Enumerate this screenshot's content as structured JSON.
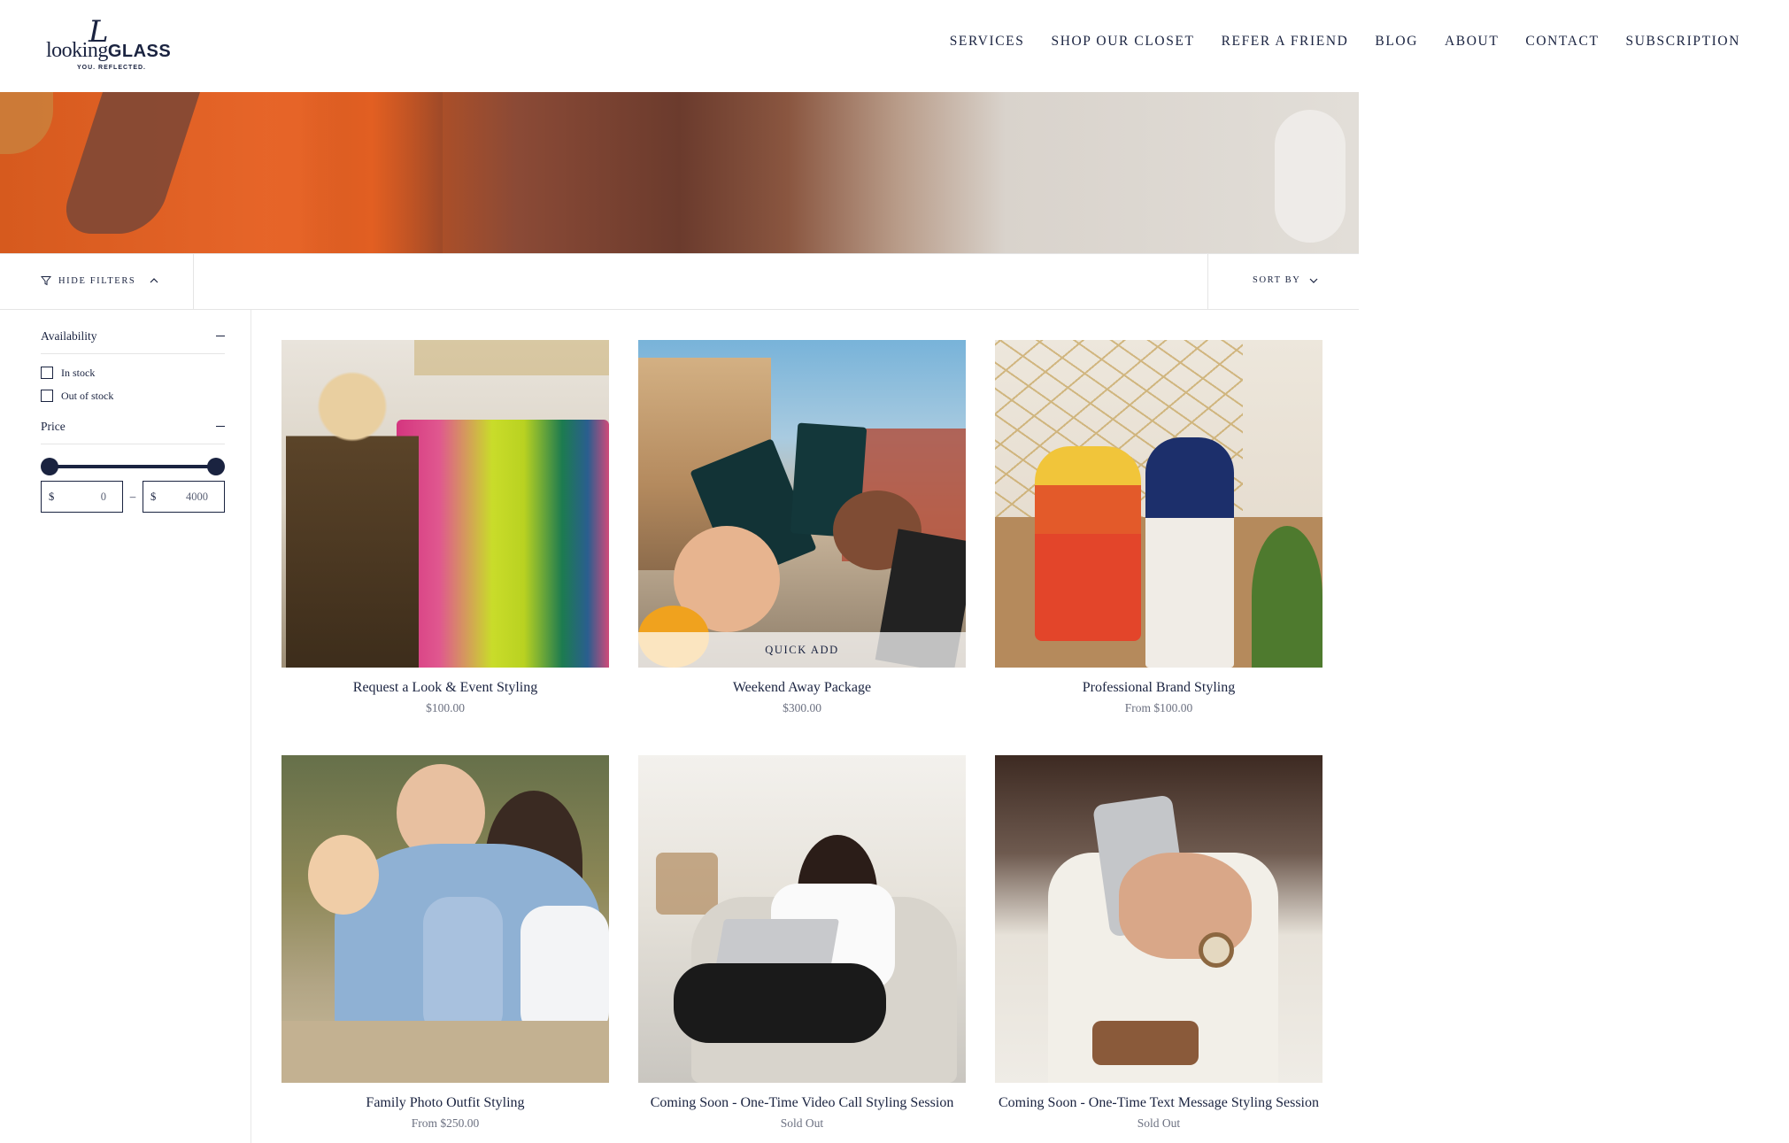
{
  "brand": {
    "logo_mark": "L",
    "logo_word": "looking",
    "logo_word_bold": "GLASS",
    "tagline": "YOU. REFLECTED."
  },
  "nav": [
    "SERVICES",
    "SHOP OUR CLOSET",
    "REFER A FRIEND",
    "BLOG",
    "ABOUT",
    "CONTACT",
    "SUBSCRIPTION"
  ],
  "toolbar": {
    "hide_filters": "HIDE FILTERS",
    "sort_by": "SORT BY"
  },
  "filters": {
    "availability": {
      "title": "Availability",
      "options": [
        "In stock",
        "Out of stock"
      ]
    },
    "price": {
      "title": "Price",
      "currency": "$",
      "min": "0",
      "max": "4000",
      "separator": "–"
    }
  },
  "products": [
    {
      "title": "Request a Look & Event Styling",
      "price": "$100.00"
    },
    {
      "title": "Weekend Away Package",
      "price": "$300.00",
      "quick_add": "QUICK ADD"
    },
    {
      "title": "Professional Brand Styling",
      "price": "From $100.00"
    },
    {
      "title": "Family Photo Outfit Styling",
      "price": "From $250.00"
    },
    {
      "title": "Coming Soon - One-Time Video Call Styling Session",
      "price": "Sold Out"
    },
    {
      "title": "Coming Soon - One-Time Text Message Styling Session",
      "price": "Sold Out"
    }
  ],
  "colors": {
    "primary": "#1a2340",
    "muted": "#6b7080",
    "border": "#e5e5e5"
  }
}
